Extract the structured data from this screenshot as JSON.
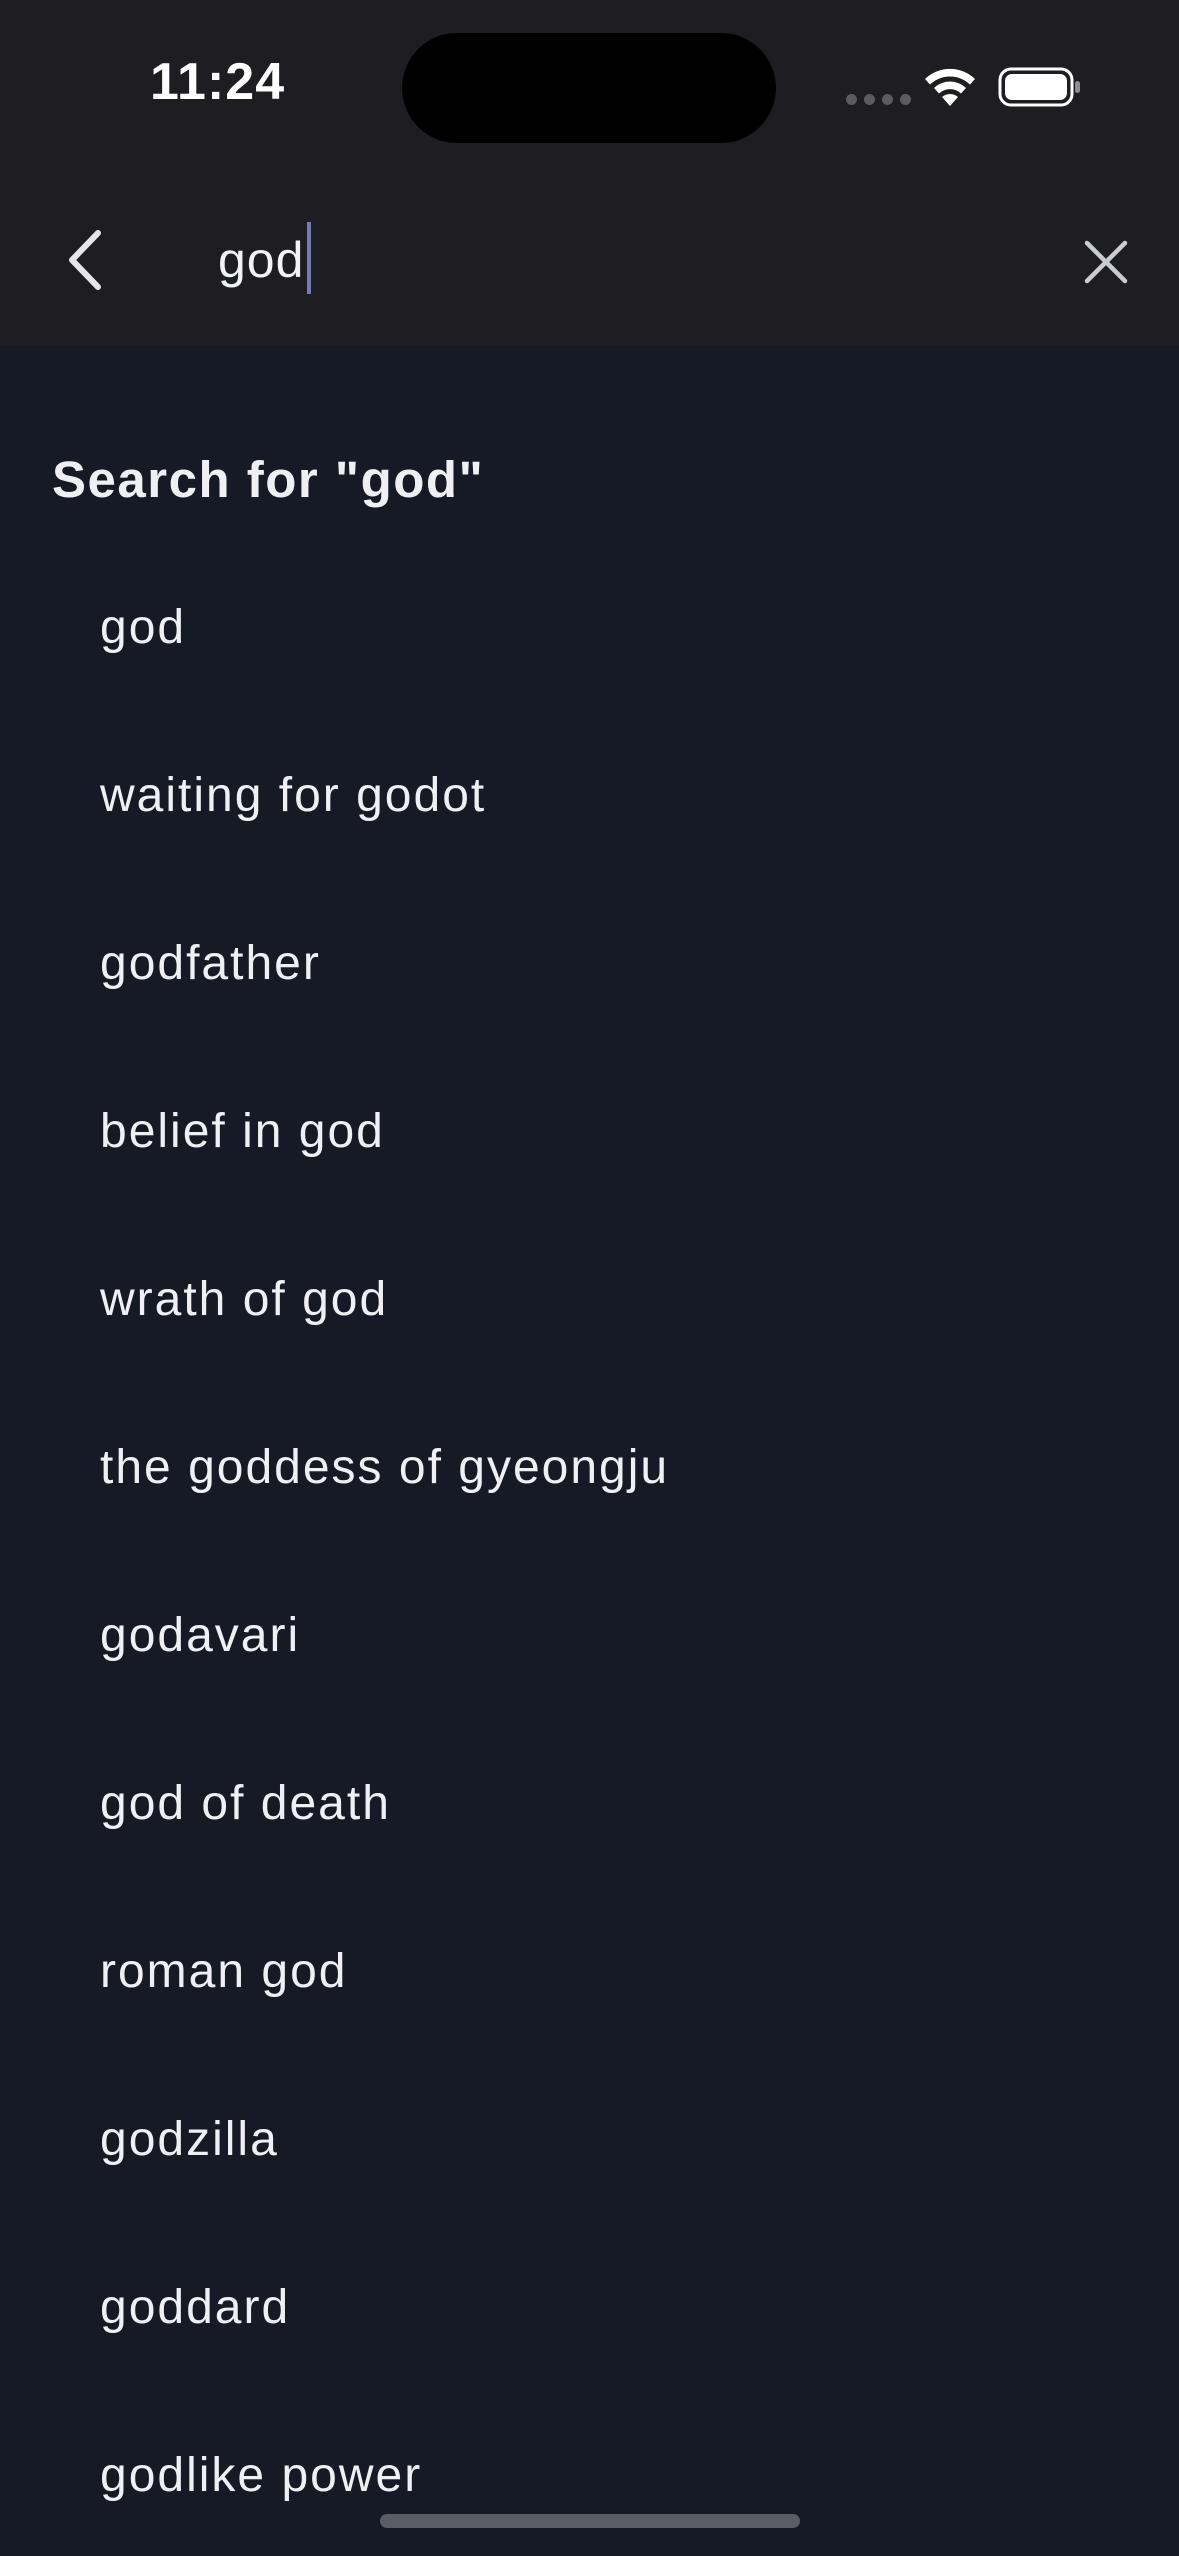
{
  "status_bar": {
    "time": "11:24"
  },
  "search": {
    "query": "god",
    "back_icon": "chevron-left-icon",
    "clear_icon": "close-icon"
  },
  "results": {
    "search_for_label": "Search for \"god\"",
    "suggestions": [
      "god",
      "waiting for godot",
      "godfather",
      "belief in god",
      "wrath of god",
      "the goddess of gyeongju",
      "godavari",
      "god of death",
      "roman god",
      "godzilla",
      "goddard",
      "godlike power"
    ]
  },
  "colors": {
    "header_bg": "#1d1d22",
    "body_bg": "#151a24",
    "text": "#eef0f4",
    "caret": "#6e7db3"
  }
}
